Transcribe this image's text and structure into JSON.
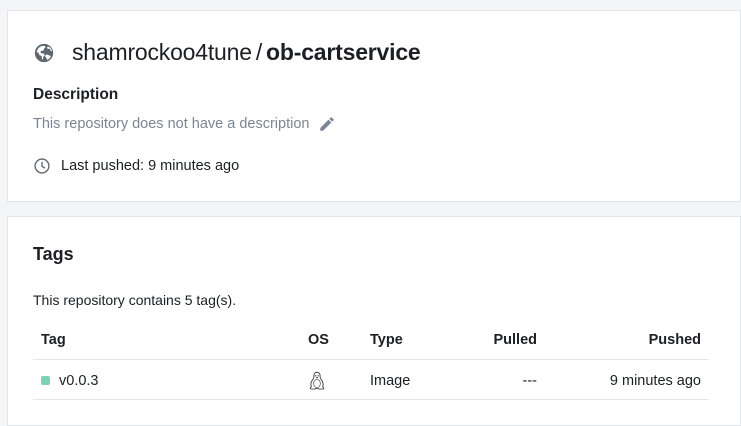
{
  "repository": {
    "owner": "shamrockoo4tune",
    "separator": "/",
    "name": "ob-cartservice",
    "visibility_icon": "globe-icon",
    "description_label": "Description",
    "description_text": "This repository does not have a description",
    "last_pushed": "Last pushed: 9 minutes ago"
  },
  "tags": {
    "title": "Tags",
    "summary": "This repository contains 5 tag(s).",
    "columns": {
      "tag": "Tag",
      "os": "OS",
      "type": "Type",
      "pulled": "Pulled",
      "pushed": "Pushed"
    },
    "rows": [
      {
        "tag": "v0.0.3",
        "status_color": "#7dd3b4",
        "os_icon": "linux-icon",
        "type": "Image",
        "pulled": "---",
        "pushed": "9 minutes ago"
      }
    ]
  },
  "colors": {
    "muted_text": "#7d8592",
    "border": "#e1e4e8",
    "background": "#f4f5f7"
  }
}
